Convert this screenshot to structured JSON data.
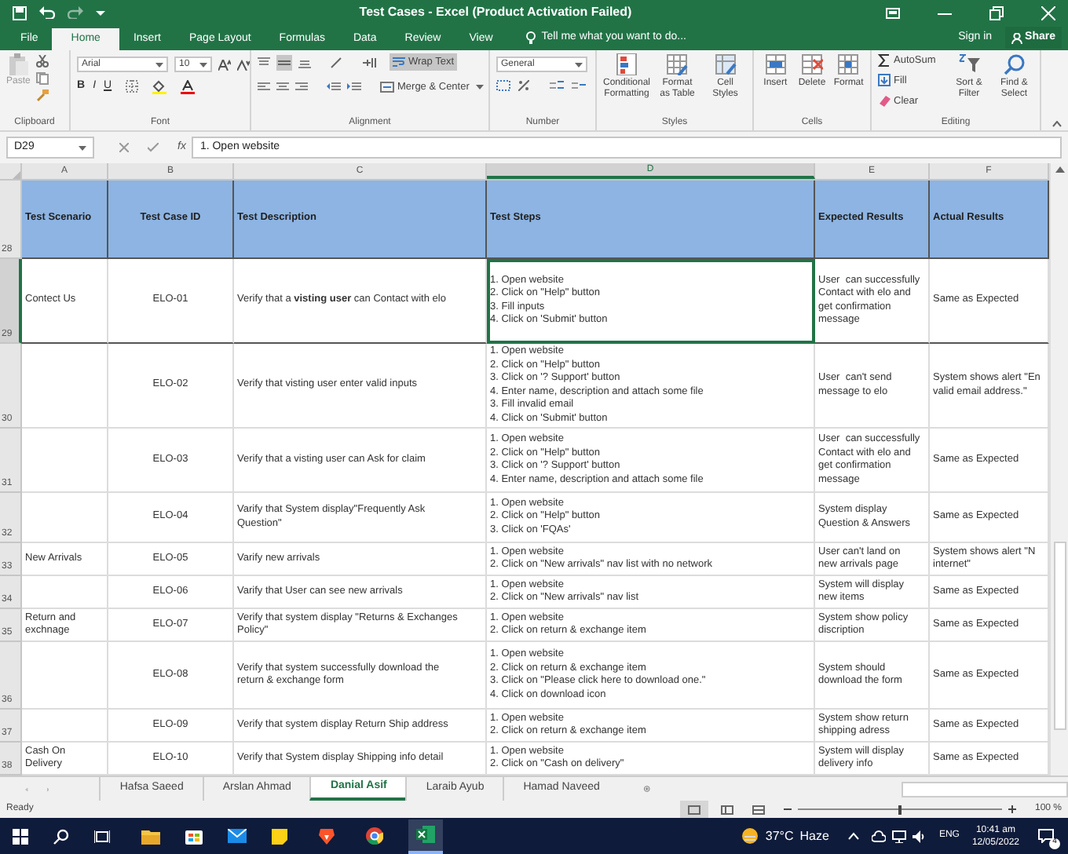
{
  "window": {
    "title": "Test Cases - Excel (Product Activation Failed)"
  },
  "ribbon_tabs": [
    {
      "label": "File",
      "selected": false
    },
    {
      "label": "Home",
      "selected": true
    },
    {
      "label": "Insert",
      "selected": false
    },
    {
      "label": "Page Layout",
      "selected": false
    },
    {
      "label": "Formulas",
      "selected": false
    },
    {
      "label": "Data",
      "selected": false
    },
    {
      "label": "Review",
      "selected": false
    },
    {
      "label": "View",
      "selected": false
    }
  ],
  "tell_me": {
    "placeholder": "Tell me what you want to do..."
  },
  "sign_in": "Sign in",
  "share": "Share",
  "ribbon": {
    "clipboard": {
      "label": "Clipboard",
      "paste": "Paste"
    },
    "font": {
      "label": "Font",
      "font_name": "Arial",
      "font_size": "10",
      "format_buttons": [
        "B",
        "I",
        "U"
      ]
    },
    "alignment": {
      "label": "Alignment",
      "wrap_text": {
        "label": "Wrap Text",
        "on": true
      },
      "merge": "Merge & Center"
    },
    "number": {
      "label": "Number",
      "format": "General"
    },
    "styles": {
      "label": "Styles",
      "buttons": [
        "Conditional Formatting",
        "Format as Table",
        "Cell Styles"
      ]
    },
    "cells": {
      "label": "Cells",
      "buttons": [
        "Insert",
        "Delete",
        "Format"
      ]
    },
    "editing": {
      "label": "Editing",
      "small_buttons": [
        "AutoSum",
        "Fill",
        "Clear"
      ],
      "buttons": [
        "Sort & Filter",
        "Find & Select"
      ]
    }
  },
  "formula_bar": {
    "name_box": "D29",
    "fx": "fx",
    "formula": "1. Open website"
  },
  "columns": [
    {
      "label": "A",
      "selected": false
    },
    {
      "label": "B",
      "selected": false
    },
    {
      "label": "C",
      "selected": false
    },
    {
      "label": "D",
      "selected": true
    },
    {
      "label": "E",
      "selected": false
    },
    {
      "label": "F",
      "selected": false
    }
  ],
  "rows": [
    {
      "number": "28",
      "selected": false,
      "header": true,
      "cells": [
        "Test Scenario",
        "Test Case ID",
        "Test Description",
        "Test Steps",
        "Expected Results",
        "Actual Results"
      ]
    },
    {
      "number": "29",
      "selected": true,
      "header": false,
      "cells": [
        "Contect Us",
        "ELO-01",
        "Verify that a **visting user** can Contact with elo",
        "1. Open website\n2. Click on \"Help\" button\n3. Fill inputs\n4. Click on 'Submit' button",
        "User  can successfully\nContact with elo and\nget confirmation\nmessage",
        "Same as Expected"
      ]
    },
    {
      "number": "30",
      "selected": false,
      "header": false,
      "cells": [
        "",
        "ELO-02",
        "Verify that visting user enter valid inputs",
        "1. Open website\n2. Click on \"Help\" button\n3. Click on '? Support' button\n4. Enter name, description and attach some file\n3. Fill invalid email\n4. Click on 'Submit' button",
        "User  can't send\nmessage to elo",
        "System shows alert \"En\nvalid email address.\""
      ]
    },
    {
      "number": "31",
      "selected": false,
      "header": false,
      "cells": [
        "",
        "ELO-03",
        "Verify that a visting user can Ask for claim",
        "1. Open website\n2. Click on \"Help\" button\n3. Click on '? Support' button\n4. Enter name, description and attach some file",
        "User  can successfully\nContact with elo and\nget confirmation\nmessage",
        "Same as Expected"
      ]
    },
    {
      "number": "32",
      "selected": false,
      "header": false,
      "cells": [
        "",
        "ELO-04",
        "Varify that System display\"Frequently Ask\nQuestion\"",
        "1. Open website\n2. Click on \"Help\" button\n3. Click on 'FQAs'",
        "System display\nQuestion & Answers",
        "Same as Expected"
      ]
    },
    {
      "number": "33",
      "selected": false,
      "header": false,
      "cells": [
        "New Arrivals",
        "ELO-05",
        "Varify new arrivals",
        "1. Open website\n2. Click on \"New arrivals\" nav list with no network",
        "User can't land on\nnew arrivals page",
        "System shows alert \"N\ninternet\""
      ]
    },
    {
      "number": "34",
      "selected": false,
      "header": false,
      "cells": [
        "",
        "ELO-06",
        "Varify that User can see new arrivals",
        "1. Open website\n2. Click on \"New arrivals\" nav list",
        "System will display\nnew items",
        "Same as Expected"
      ]
    },
    {
      "number": "35",
      "selected": false,
      "header": false,
      "cells": [
        "Return and\nexchnage",
        "ELO-07",
        "Verify that system display \"Returns & Exchanges\nPolicy\"",
        "1. Open website\n2. Click on return & exchange item",
        "System show policy\ndiscription",
        "Same as Expected"
      ]
    },
    {
      "number": "36",
      "selected": false,
      "header": false,
      "cells": [
        "",
        "ELO-08",
        "Verify that system successfully download the\nreturn & exchange form",
        "1. Open website\n2. Click on return & exchange item\n3. Click on \"Please click here to download one.\"\n4. Click on download icon",
        "System should\ndownload the form",
        "Same as Expected"
      ]
    },
    {
      "number": "37",
      "selected": false,
      "header": false,
      "cells": [
        "",
        "ELO-09",
        "Verify that system display Return Ship address",
        "1. Open website\n2. Click on return & exchange item",
        "System show return\nshipping adress",
        "Same as Expected"
      ]
    },
    {
      "number": "38",
      "selected": false,
      "header": false,
      "cells": [
        "Cash On\nDelivery",
        "ELO-10",
        "Verify that System display Shipping info detail",
        "1. Open website\n2. Click on \"Cash on delivery\"",
        "System will display\ndelivery info",
        "Same as Expected"
      ]
    }
  ],
  "sheet_tabs": [
    {
      "label": "Hafsa Saeed",
      "selected": false
    },
    {
      "label": "Arslan Ahmad",
      "selected": false
    },
    {
      "label": "Danial Asif",
      "selected": true
    },
    {
      "label": "Laraib Ayub",
      "selected": false
    },
    {
      "label": "Hamad Naveed",
      "selected": false
    }
  ],
  "status_bar": {
    "status": "Ready",
    "zoom": {
      "level": 0.5
    },
    "zoom_label": "100 %"
  },
  "taskbar": {
    "weather": {
      "temperature": "37°C",
      "condition": "Haze"
    },
    "language": "ENG",
    "time": "10:41 am",
    "date": "12/05/2022",
    "notifications": "4"
  }
}
